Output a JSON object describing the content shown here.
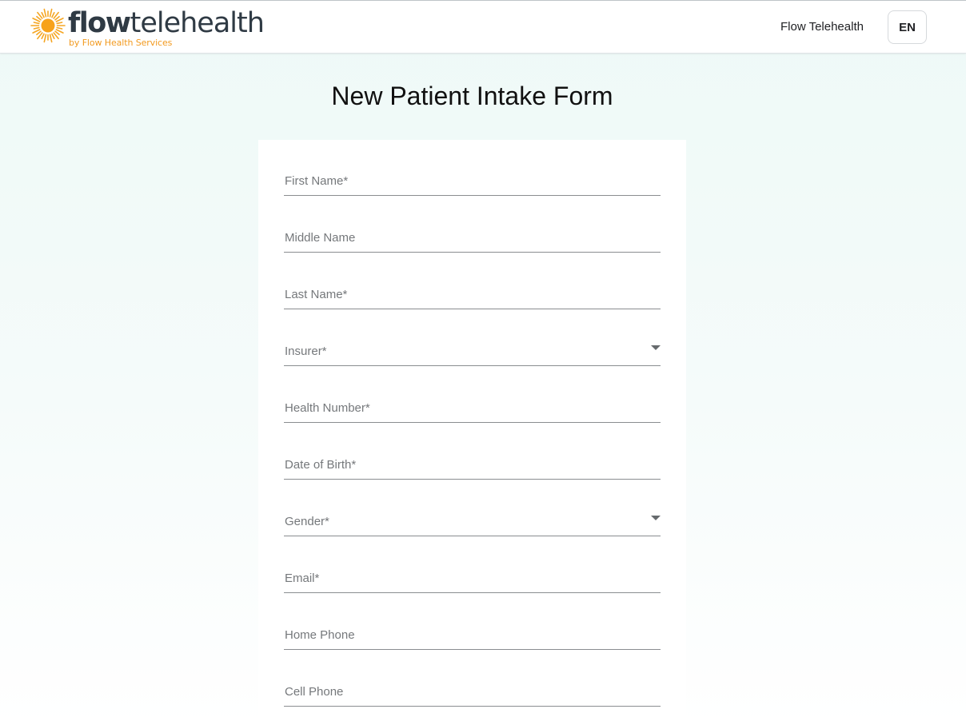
{
  "header": {
    "logo": {
      "word_bold": "flow",
      "word_light": "telehealth",
      "tagline": "by Flow Health Services",
      "sun_color": "#f5a623"
    },
    "brand_link": "Flow Telehealth",
    "language": "EN"
  },
  "page": {
    "title": "New Patient Intake Form"
  },
  "form": {
    "fields": [
      {
        "name": "first-name",
        "placeholder": "First Name*",
        "type": "text"
      },
      {
        "name": "middle-name",
        "placeholder": "Middle Name",
        "type": "text"
      },
      {
        "name": "last-name",
        "placeholder": "Last Name*",
        "type": "text"
      },
      {
        "name": "insurer",
        "placeholder": "Insurer*",
        "type": "select"
      },
      {
        "name": "health-number",
        "placeholder": "Health Number*",
        "type": "text"
      },
      {
        "name": "date-of-birth",
        "placeholder": "Date of Birth*",
        "type": "text"
      },
      {
        "name": "gender",
        "placeholder": "Gender*",
        "type": "select"
      },
      {
        "name": "email",
        "placeholder": "Email*",
        "type": "text"
      },
      {
        "name": "home-phone",
        "placeholder": "Home Phone",
        "type": "text"
      },
      {
        "name": "cell-phone",
        "placeholder": "Cell Phone",
        "type": "text"
      }
    ]
  },
  "colors": {
    "accent_orange": "#f29a1f",
    "logo_text": "#2f3a44",
    "background_tint": "#eef9f7"
  }
}
